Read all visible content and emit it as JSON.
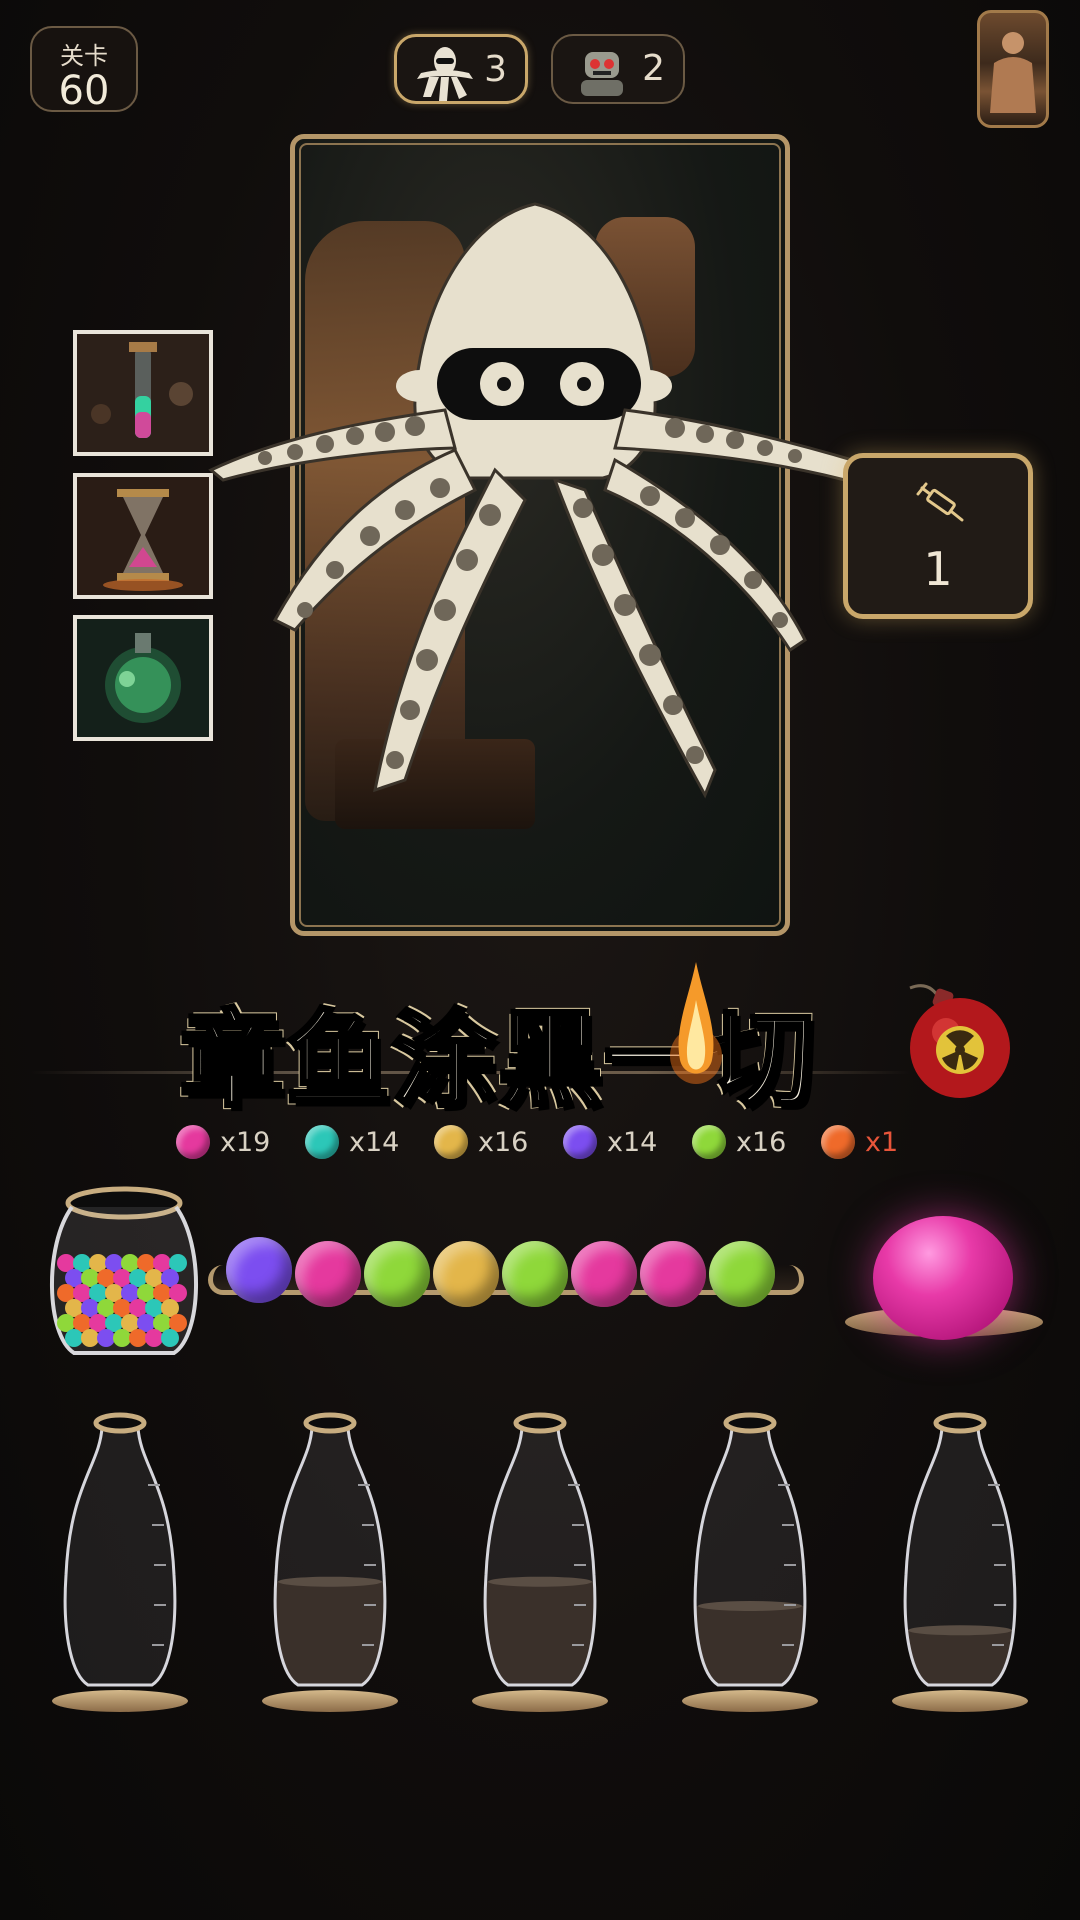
{
  "level": {
    "label": "关卡",
    "number": "60"
  },
  "enemies": [
    {
      "name": "octopus-enemy",
      "count": "3",
      "active": true
    },
    {
      "name": "robot-enemy",
      "count": "2",
      "active": false
    }
  ],
  "syringe": {
    "icon": "syringe-icon",
    "count": "1"
  },
  "title": "章鱼涂黑一切",
  "ball_counts": [
    {
      "color": "#e5399e",
      "text": "x19",
      "text_color": "#d9d2c4"
    },
    {
      "color": "#2cc7b8",
      "text": "x14",
      "text_color": "#d9d2c4"
    },
    {
      "color": "#e3b64a",
      "text": "x16",
      "text_color": "#d9d2c4"
    },
    {
      "color": "#7c4ef0",
      "text": "x14",
      "text_color": "#d9d2c4"
    },
    {
      "color": "#8fd83a",
      "text": "x16",
      "text_color": "#d9d2c4"
    },
    {
      "color": "#ef6a2a",
      "text": "x1",
      "text_color": "#e8553a"
    }
  ],
  "queue": [
    "#7c4ef0",
    "#e5399e",
    "#8fd83a",
    "#e3b64a",
    "#8fd83a",
    "#e5399e",
    "#e5399e",
    "#8fd83a"
  ],
  "current_ball": {
    "color": "#e5399e"
  },
  "bottles": [
    {
      "fill": 0.0
    },
    {
      "fill": 0.65
    },
    {
      "fill": 0.65
    },
    {
      "fill": 0.5
    },
    {
      "fill": 0.35
    }
  ],
  "side_thumbnails": [
    "test-tube-thumbnail",
    "hourglass-thumbnail",
    "green-flask-thumbnail"
  ],
  "colors": {
    "accent_gold": "#c9a76a",
    "background": "#100d0c"
  }
}
